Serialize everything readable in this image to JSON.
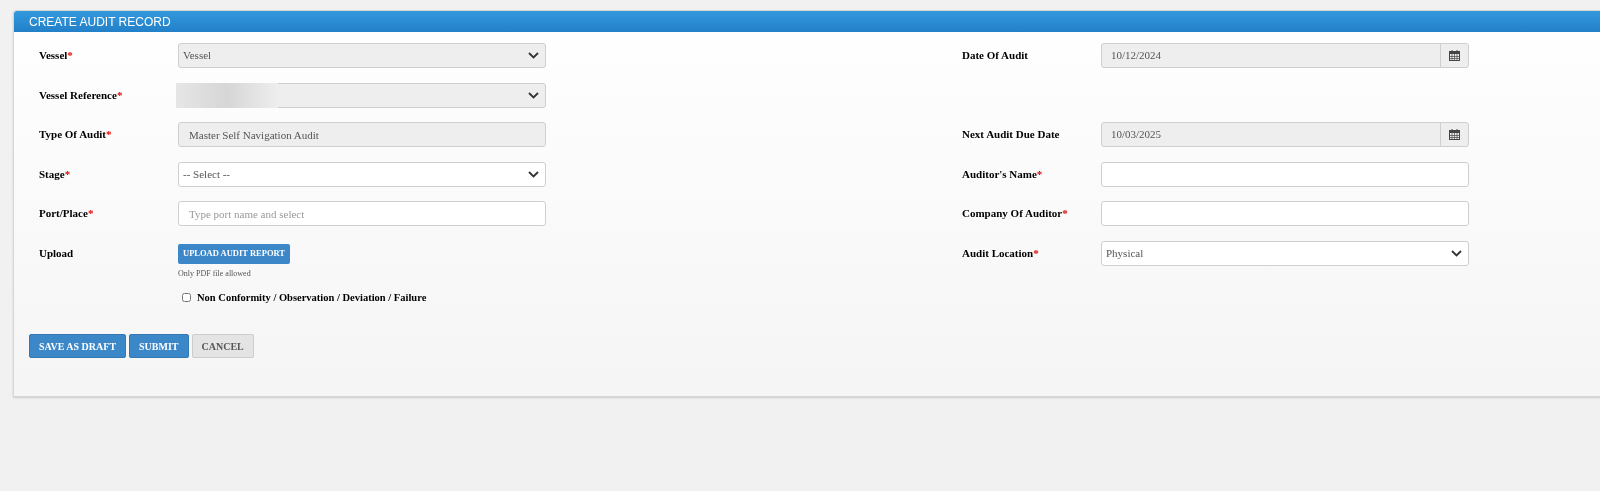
{
  "panel": {
    "title": "CREATE AUDIT RECORD"
  },
  "rows": [
    {
      "left": {
        "label": "Vessel",
        "required_mark": "*",
        "kind": "select",
        "value": "Vessel",
        "disabled": true
      },
      "right": {
        "label": "Date Of Audit",
        "kind": "date",
        "value": "10/12/2024",
        "disabled": true
      }
    },
    {
      "left": {
        "label": "Vessel Reference",
        "required_mark": "*",
        "kind": "select",
        "redacted": true,
        "disabled": true
      }
    },
    {
      "left": {
        "label": "Type Of Audit",
        "required_mark": "*",
        "kind": "text",
        "value": "Master Self Navigation Audit",
        "disabled": true
      },
      "right": {
        "label": "Next Audit Due Date",
        "kind": "date",
        "value": "10/03/2025",
        "disabled": true
      }
    },
    {
      "left": {
        "label": "Stage",
        "required_mark": "*",
        "kind": "select",
        "value": "-- Select --",
        "disabled": false
      },
      "right": {
        "label": "Auditor's Name",
        "required_mark": "*",
        "kind": "text",
        "disabled": false
      }
    },
    {
      "left": {
        "label": "Port/Place",
        "required_mark": "*",
        "kind": "text",
        "placeholder": "Type port name and select",
        "disabled": false
      },
      "right": {
        "label": "Company Of Auditor",
        "required_mark": "*",
        "kind": "text",
        "disabled": false
      }
    },
    {
      "left": {
        "label": "Upload",
        "kind": "upload",
        "button": "UPLOAD AUDIT REPORT",
        "note": "Only PDF file allowed"
      },
      "right": {
        "label": "Audit Location",
        "required_mark": "*",
        "kind": "select",
        "value": "Physical",
        "disabled": false
      }
    }
  ],
  "checkbox": {
    "label": "Non Conformity / Observation / Deviation / Failure",
    "checked": false
  },
  "buttons": [
    {
      "label": "SAVE AS DRAFT",
      "kind": "primary"
    },
    {
      "label": "SUBMIT",
      "kind": "primary"
    },
    {
      "label": "CANCEL",
      "kind": "secondary"
    }
  ]
}
